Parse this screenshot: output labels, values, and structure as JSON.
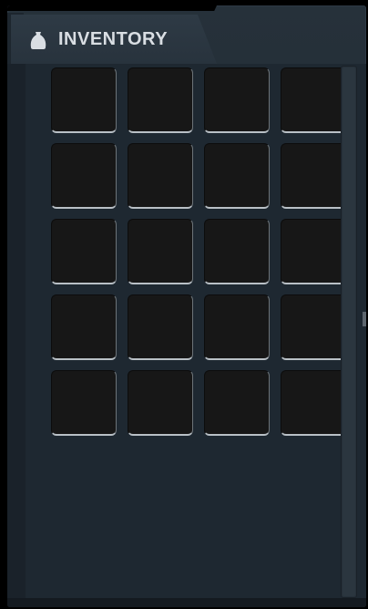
{
  "inventory": {
    "title": "INVENTORY",
    "icon": "bag-icon",
    "columns": 4,
    "rows": 5,
    "slots": [
      {
        "item": null
      },
      {
        "item": null
      },
      {
        "item": null
      },
      {
        "item": null
      },
      {
        "item": null
      },
      {
        "item": null
      },
      {
        "item": null
      },
      {
        "item": null
      },
      {
        "item": null
      },
      {
        "item": null
      },
      {
        "item": null
      },
      {
        "item": null
      },
      {
        "item": null
      },
      {
        "item": null
      },
      {
        "item": null
      },
      {
        "item": null
      },
      {
        "item": null
      },
      {
        "item": null
      },
      {
        "item": null
      },
      {
        "item": null
      }
    ]
  },
  "colors": {
    "panel": "#222c35",
    "slot": "#171717",
    "slot_highlight": "#b9c0c6",
    "title": "#d9dee3"
  }
}
